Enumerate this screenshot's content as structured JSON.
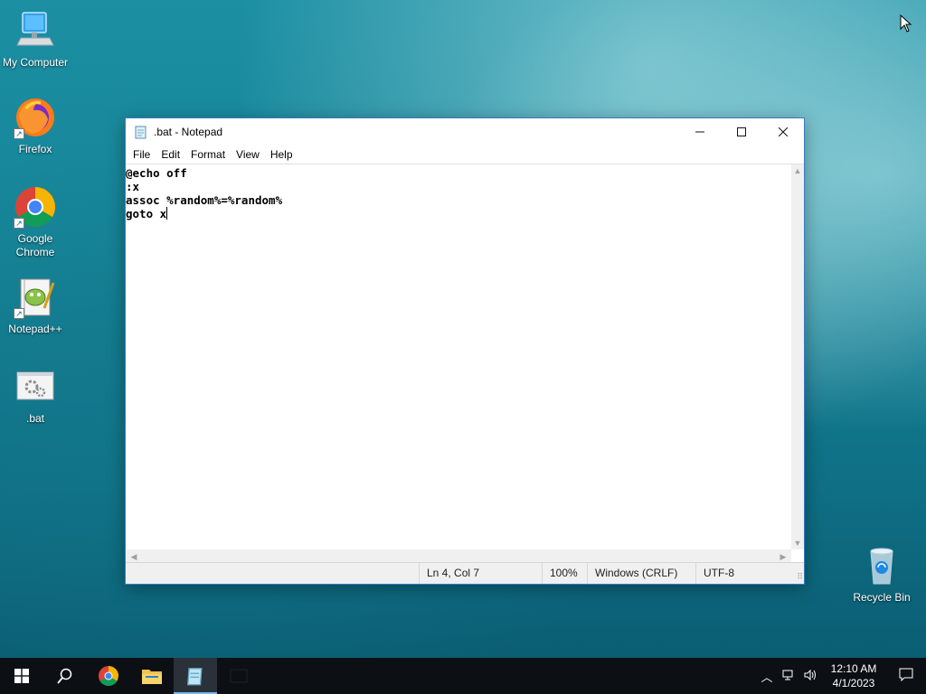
{
  "desktop": {
    "icons": [
      {
        "label": "My Computer",
        "icon": "computer-icon"
      },
      {
        "label": "Firefox",
        "icon": "firefox-icon"
      },
      {
        "label": "Google\nChrome",
        "icon": "chrome-icon"
      },
      {
        "label": "Notepad++",
        "icon": "notepadpp-icon"
      },
      {
        "label": ".bat",
        "icon": "bat-file-icon"
      },
      {
        "label": "Recycle Bin",
        "icon": "recycle-bin-icon"
      }
    ]
  },
  "notepad": {
    "title": ".bat - Notepad",
    "menu": [
      "File",
      "Edit",
      "Format",
      "View",
      "Help"
    ],
    "lines": [
      "@echo off",
      ":x",
      "assoc %random%=%random%",
      "goto x"
    ],
    "status": {
      "position": "Ln 4, Col 7",
      "zoom": "100%",
      "line_ending": "Windows (CRLF)",
      "encoding": "UTF-8"
    }
  },
  "taskbar": {
    "time": "12:10 AM",
    "date": "4/1/2023"
  },
  "colors": {
    "taskbar": "#0c1014",
    "active_indicator": "#76b9ed",
    "window_border": "#3a7bc8"
  }
}
